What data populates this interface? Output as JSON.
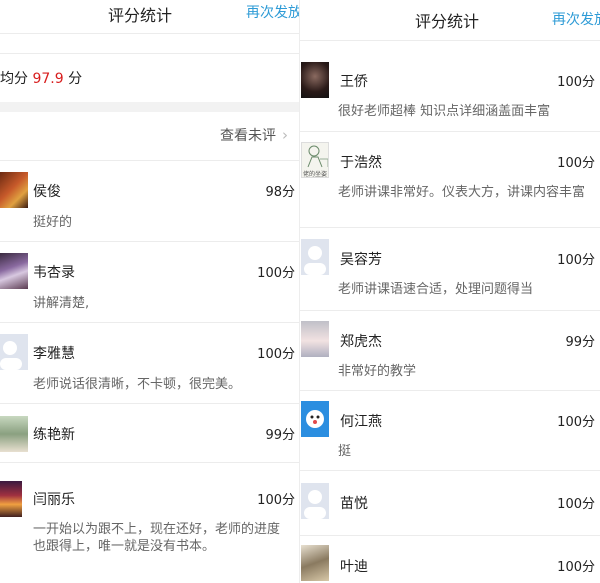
{
  "left": {
    "title": "评分统计",
    "resend": "再次发放",
    "avg_prefix": "均分",
    "avg_value": "97.9",
    "avg_unit": "分",
    "view_unrated": "查看未评",
    "chevron": "›",
    "entries": [
      {
        "name": "侯俊",
        "score": "98分",
        "comment": "挺好的",
        "avatar": "avatar-photo-warm"
      },
      {
        "name": "韦杏录",
        "score": "100分",
        "comment": "讲解清楚,",
        "avatar": "avatar-photo-purple"
      },
      {
        "name": "李雅慧",
        "score": "100分",
        "comment": "老师说话很清晰，不卡顿，很完美。",
        "avatar": "avatar-default"
      },
      {
        "name": "练艳新",
        "score": "99分",
        "comment": "",
        "avatar": "avatar-photo-child"
      },
      {
        "name": "闫丽乐",
        "score": "100分",
        "comment": "一开始以为跟不上，现在还好，老师的进度也跟得上，唯一就是没有书本。",
        "avatar": "avatar-photo-sunset"
      }
    ]
  },
  "right": {
    "title": "评分统计",
    "resend": "再次发放",
    "entries": [
      {
        "name": "王侨",
        "score": "100分",
        "comment": "很好老师超棒 知识点详细涵盖面丰富",
        "avatar": "avatar-photo-dark"
      },
      {
        "name": "于浩然",
        "score": "100分",
        "comment": "老师讲课非常好。仪表大方，讲课内容丰富",
        "avatar": "avatar-sketch",
        "avatar_caption": "佬的坐姿"
      },
      {
        "name": "吴容芳",
        "score": "100分",
        "comment": "老师讲课语速合适，处理问题得当",
        "avatar": "avatar-default"
      },
      {
        "name": "郑虎杰",
        "score": "99分",
        "comment": "非常好的教学",
        "avatar": "avatar-anime"
      },
      {
        "name": "何江燕",
        "score": "100分",
        "comment": "挺",
        "avatar": "avatar-blue-cartoon"
      },
      {
        "name": "苗悦",
        "score": "100分",
        "comment": "",
        "avatar": "avatar-default"
      },
      {
        "name": "叶迪",
        "score": "100分",
        "comment": "",
        "avatar": "avatar-photo-cat"
      }
    ]
  }
}
